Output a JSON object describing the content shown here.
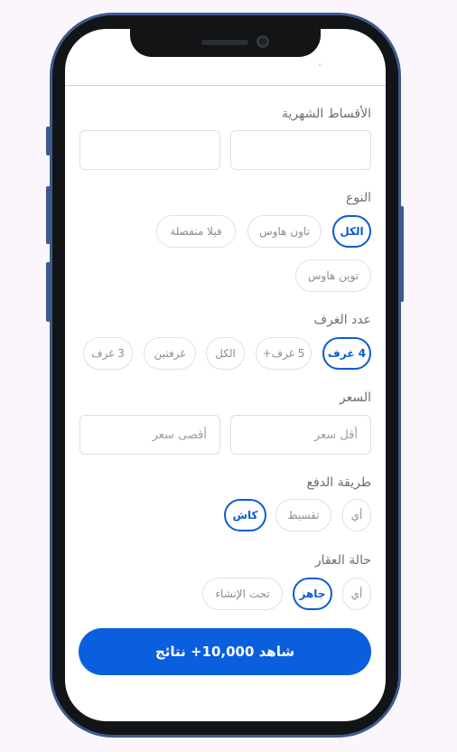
{
  "header": {
    "ghost_text": "،"
  },
  "monthly": {
    "label": "الأقساط الشهرية"
  },
  "type": {
    "label": "النوع",
    "options": [
      "الكل",
      "تاون هاوس",
      "فيلا منفصلة",
      "توين هاوس"
    ]
  },
  "rooms": {
    "label": "عدد الغرف",
    "options": [
      "4 غرف",
      "5 غرف+",
      "الكل",
      "غرفتين",
      "3 غرف"
    ]
  },
  "price": {
    "label": "السعر",
    "min_placeholder": "أقل سعر",
    "max_placeholder": "أقصى سعر"
  },
  "payment": {
    "label": "طريقة الدفع",
    "options": [
      "أي",
      "تقسيط",
      "كاش"
    ]
  },
  "status": {
    "label": "حالة العقار",
    "options": [
      "أي",
      "جاهز",
      "تحت الإنشاء"
    ]
  },
  "cta": {
    "label": "شاهد 10,000+ نتائج"
  },
  "colors": {
    "accent": "#0a5fde",
    "frame": "#3d5a8c"
  }
}
